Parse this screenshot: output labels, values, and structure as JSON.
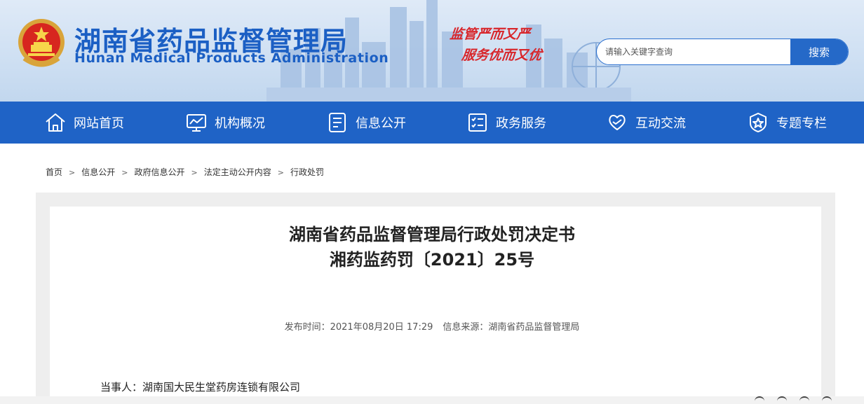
{
  "header": {
    "title": "湖南省药品监督管理局",
    "subtitle": "Hunan Medical Products Administration",
    "slogan": [
      "监管严而又严",
      "服务优而又优"
    ],
    "search": {
      "placeholder": "请输入关键字查询",
      "button_label": "搜索"
    }
  },
  "nav": {
    "items": [
      {
        "label": "网站首页",
        "icon": "home-icon"
      },
      {
        "label": "机构概况",
        "icon": "chart-monitor-icon"
      },
      {
        "label": "信息公开",
        "icon": "document-list-icon"
      },
      {
        "label": "政务服务",
        "icon": "checklist-icon"
      },
      {
        "label": "互动交流",
        "icon": "heart-hands-icon"
      },
      {
        "label": "专题专栏",
        "icon": "star-badge-icon"
      }
    ]
  },
  "breadcrumb": [
    "首页",
    "信息公开",
    "政府信息公开",
    "法定主动公开内容",
    "行政处罚"
  ],
  "article": {
    "title_line1": "湖南省药品监督管理局行政处罚决定书",
    "title_line2": "湘药监药罚〔2021〕25号",
    "publish_time": "发布时间：2021年08月20日 17:29",
    "source": "信息来源：湖南省药品监督管理局",
    "party": "当事人：湖南国大民生堂药房连锁有限公司"
  },
  "colors": {
    "brand_blue": "#1f63c6",
    "slogan_red": "#d8262b"
  }
}
